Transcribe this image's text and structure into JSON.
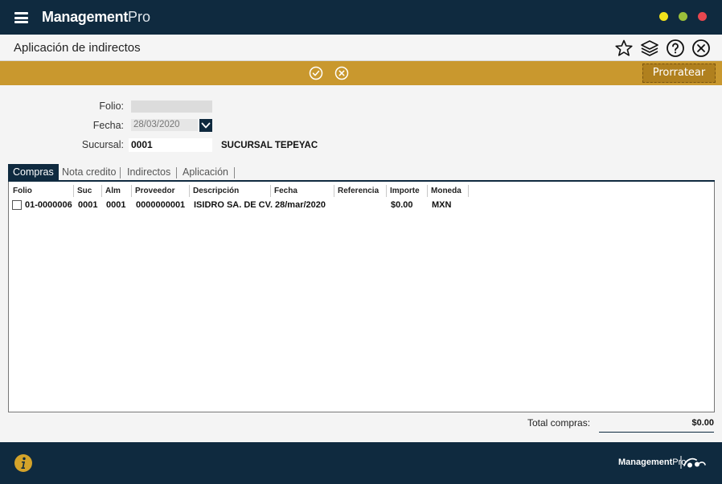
{
  "titlebar": {
    "brand_bold": "Management",
    "brand_light": "Pro",
    "colors": {
      "background": "#0f2a3f",
      "dot_yellow": "#f2e21a",
      "dot_green": "#9bbf3a",
      "dot_red": "#e8474f"
    }
  },
  "header": {
    "title": "Aplicación de indirectos",
    "icons": [
      "star-icon",
      "layers-icon",
      "help-icon",
      "close-icon"
    ]
  },
  "actionbar": {
    "icons": [
      "check-circle-icon",
      "cancel-circle-icon"
    ],
    "prorratear_label": "Prorratear",
    "color": "#c9982e"
  },
  "form": {
    "folio_label": "Folio:",
    "folio_value": "",
    "fecha_label": "Fecha:",
    "fecha_value": "28/03/2020",
    "sucursal_label": "Sucursal:",
    "sucursal_code": "0001",
    "sucursal_name": "SUCURSAL TEPEYAC"
  },
  "tabs": [
    {
      "label": "Compras",
      "active": true
    },
    {
      "label": "Nota credito",
      "active": false
    },
    {
      "label": "Indirectos",
      "active": false
    },
    {
      "label": "Aplicación",
      "active": false
    }
  ],
  "table": {
    "columns": [
      "Folio",
      "Suc",
      "Alm",
      "Proveedor",
      "Descripción",
      "Fecha",
      "Referencia",
      "Importe",
      "Moneda"
    ],
    "rows": [
      {
        "folio": "01-0000006",
        "suc": "0001",
        "alm": "0001",
        "proveedor": "0000000001",
        "descripcion": "ISIDRO SA. DE CV.",
        "fecha": "28/mar/2020",
        "referencia": "",
        "importe": "$0.00",
        "moneda": "MXN"
      }
    ]
  },
  "totals": {
    "label": "Total compras:",
    "value": "$0.00"
  },
  "footer": {
    "brand_bold": "Management",
    "brand_light": "Pro"
  }
}
